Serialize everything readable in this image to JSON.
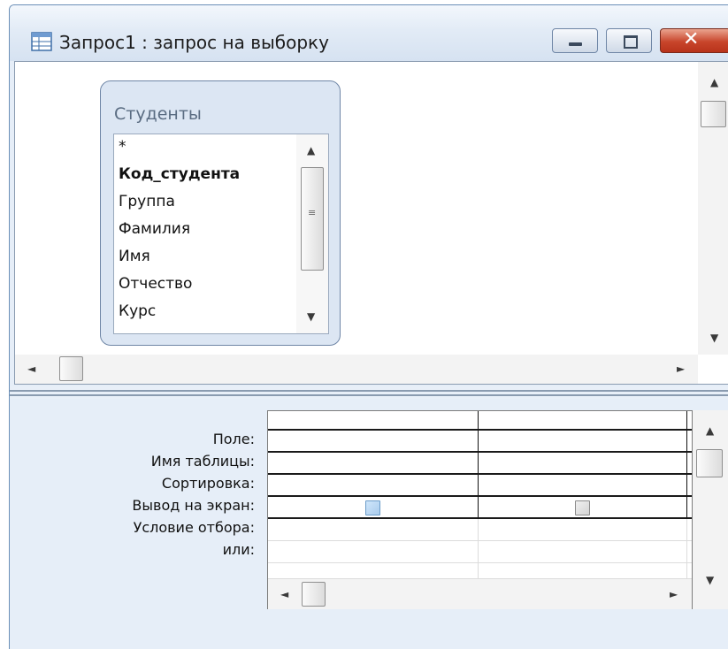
{
  "window": {
    "title": "Запрос1 : запрос на выборку",
    "icon": "query-icon",
    "controls": [
      "minimize-icon",
      "maximize-icon",
      "close-icon"
    ],
    "close_glyph": "✕"
  },
  "table": {
    "name": "Студенты",
    "fields": [
      {
        "label": "*",
        "primary_key": false
      },
      {
        "label": "Код_студента",
        "primary_key": true
      },
      {
        "label": "Группа",
        "primary_key": false
      },
      {
        "label": "Фамилия",
        "primary_key": false
      },
      {
        "label": "Имя",
        "primary_key": false
      },
      {
        "label": "Отчество",
        "primary_key": false
      },
      {
        "label": "Курс",
        "primary_key": false
      }
    ]
  },
  "design_grid": {
    "row_labels": [
      "Поле:",
      "Имя таблицы:",
      "Сортировка:",
      "Вывод на экран:",
      "Условие отбора:",
      "или:"
    ],
    "columns": [
      {
        "field": "",
        "table": "",
        "sort": "",
        "show": true,
        "criteria": "",
        "or": ""
      },
      {
        "field": "",
        "table": "",
        "sort": "",
        "show": true,
        "criteria": "",
        "or": ""
      }
    ]
  },
  "scroll_glyphs": {
    "up": "▲",
    "down": "▼",
    "left": "◄",
    "right": "►"
  },
  "colors": {
    "window_frame": "#e6eef8",
    "close_button": "#c8452b",
    "title_text": "#1c1c1c"
  }
}
